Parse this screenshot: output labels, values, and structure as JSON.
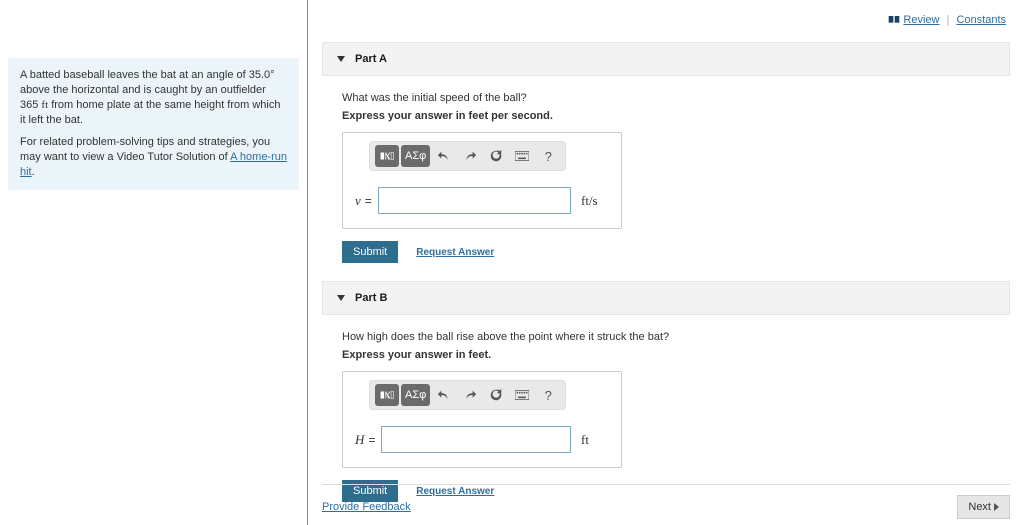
{
  "top": {
    "review": "Review",
    "constants": "Constants"
  },
  "problem": {
    "paragraph1_a": "A batted baseball leaves the bat at an angle of 35.0",
    "paragraph1_deg": "°",
    "paragraph1_b": " above the horizontal and is caught by an outfielder 365 ",
    "paragraph1_unit": "ft",
    "paragraph1_c": " from home plate at the same height from which it left the bat.",
    "paragraph2_a": "For related problem-solving tips and strategies, you may want to view a Video Tutor Solution of ",
    "tutor_link": "A home-run hit",
    "paragraph2_b": "."
  },
  "partA": {
    "header": "Part A",
    "question": "What was the initial speed of the ball?",
    "instruction": "Express your answer in feet per second.",
    "var": "v",
    "eq": "=",
    "value": "",
    "unit": "ft/s",
    "greek_label": "ΑΣφ"
  },
  "partB": {
    "header": "Part B",
    "question": "How high does the ball rise above the point where it struck the bat?",
    "instruction": "Express your answer in feet.",
    "var": "H",
    "eq": "=",
    "value": "",
    "unit": "ft",
    "greek_label": "ΑΣφ"
  },
  "actions": {
    "submit": "Submit",
    "request": "Request Answer",
    "feedback": "Provide Feedback",
    "next": "Next"
  }
}
